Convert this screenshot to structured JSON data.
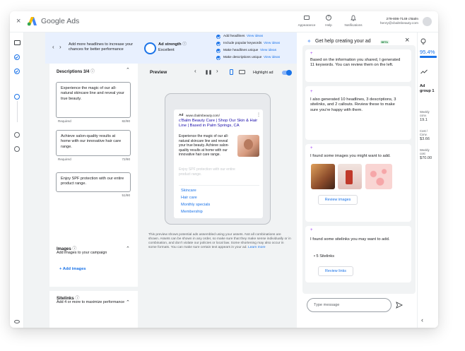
{
  "header": {
    "app_name": "Google Ads",
    "appearance": "Appearance",
    "help": "Help",
    "notifications": "Notifications",
    "phone": "279-806-7149 c'Balm",
    "email": "henry@cbalmbeauty.com"
  },
  "banner": {
    "tip": "Add more headlines to increase your chances for better performance",
    "ad_strength_label": "Ad strength",
    "ad_strength_value": "Excellent",
    "checklist": [
      {
        "text": "Add headlines",
        "link": "View ideas"
      },
      {
        "text": "Include popular keywords",
        "link": "View ideas"
      },
      {
        "text": "Make headlines unique",
        "link": "View ideas"
      },
      {
        "text": "Make descriptions unique",
        "link": "View ideas"
      }
    ]
  },
  "descriptions": {
    "title": "Descriptions 3/4",
    "fields": [
      {
        "text": "Experience the magic of our all-natural skincare line and reveal your true beauty.",
        "status": "Required",
        "count": "82/90"
      },
      {
        "text": "Achieve salon-quality results at home with our innovative hair care range.",
        "status": "Required",
        "count": "72/90"
      },
      {
        "text": "Enjoy SPF protection with our entire product range.",
        "status": "",
        "count": "51/90"
      }
    ]
  },
  "images_section": {
    "title": "Images",
    "subtitle": "Add images to your campaign",
    "add_label": "Add images"
  },
  "sitelinks_section": {
    "title": "Sitelinks",
    "subtitle": "Add 4 or more to maximize performance"
  },
  "preview": {
    "title": "Preview",
    "highlight_label": "Highlight ad",
    "ad_badge": "Ad",
    "ad_url": "www.cbalmbeauty.com/",
    "headline": "c'Balm Beauty Care | Shop Our Skin & Hair Line | Based in Palm Springs, CA",
    "description": "Experience the magic of our all-natural skincare line and reveal your true beauty. Achieve salon-quality results at home with our innovative hair care range.",
    "faded": "Enjoy SPF protection with our entire product range.",
    "sitelinks": [
      "Skincare",
      "Hair care",
      "Monthly specials",
      "Membership"
    ],
    "footnote": "This preview shows potential ads assembled using your assets. Not all combinations are shown. Assets can be shown in any order, so make sure that they make sense individually or in combination, and don't violate our policies or local law. Some shortening may also occur in some formats. You can make sure certain text appears in your ad.",
    "learn_more": "Learn more"
  },
  "assistant": {
    "title": "Get help creating your ad",
    "beta": "BETA",
    "msg1": "Based on the information you shared, I generated 11 keywords. You can review them on the left.",
    "msg2": "I also generated 10 headlines, 3 descriptions, 3 sitelinks, and 2 callouts. Review these to make sure you're happy with them.",
    "msg3": "I found some images you might want to add.",
    "review_images": "Review images",
    "msg4": "I found some sitelinks you may want to add.",
    "sitelinks_bullet": "5 Sitelinks",
    "review_links": "Review links",
    "input_placeholder": "Type message"
  },
  "right_panel": {
    "percent": "95.4%",
    "ad": "Ad",
    "group": "group 1",
    "stats": [
      {
        "label": "Weekly conv.",
        "value": "19.1"
      },
      {
        "label": "Cost / Conv.",
        "value": "$3.66"
      },
      {
        "label": "Weekly cost",
        "value": "$70.00"
      }
    ]
  },
  "colors": {
    "accent": "#1a73e8",
    "sparkle": "#a142f4",
    "banner": "#e8f0fe"
  }
}
